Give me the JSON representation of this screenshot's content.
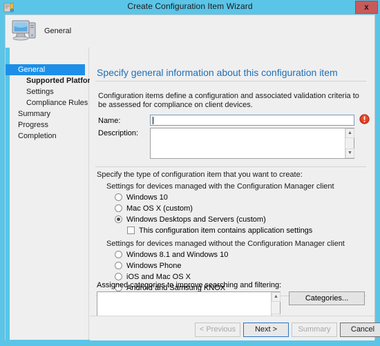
{
  "window": {
    "title": "Create Configuration Item Wizard",
    "icon": "wizard-icon",
    "close_label": "x",
    "titlebar_color": "#5bc5e8"
  },
  "header": {
    "icon": "computer-monitor-icon",
    "label": "General"
  },
  "sidebar": {
    "items": [
      {
        "label": "General",
        "level": 0,
        "active": true,
        "bold": false
      },
      {
        "label": "Supported Platforms",
        "level": 1,
        "active": false,
        "bold": true
      },
      {
        "label": "Settings",
        "level": 1,
        "active": false,
        "bold": false
      },
      {
        "label": "Compliance Rules",
        "level": 1,
        "active": false,
        "bold": false
      },
      {
        "label": "Summary",
        "level": 0,
        "active": false,
        "bold": false
      },
      {
        "label": "Progress",
        "level": 0,
        "active": false,
        "bold": false
      },
      {
        "label": "Completion",
        "level": 0,
        "active": false,
        "bold": false
      }
    ],
    "active_color": "#1d8fe8"
  },
  "content": {
    "title": "Specify general information about this configuration item",
    "title_color": "#1f6fb4",
    "intro": "Configuration items define a configuration and associated validation criteria to be assessed for compliance on client devices.",
    "name_label": "Name:",
    "name_value": "",
    "name_error_icon": "error-exclamation-icon",
    "description_label": "Description:",
    "description_value": "",
    "scroll_up_icon": "chevron-up-icon",
    "scroll_down_icon": "chevron-down-icon",
    "type_prompt": "Specify the type of configuration item that you want to create:",
    "managed_group_label": "Settings for devices managed with the Configuration Manager client",
    "managed_options": [
      {
        "label": "Windows 10",
        "selected": false
      },
      {
        "label": "Mac OS X (custom)",
        "selected": false
      },
      {
        "label": "Windows Desktops and Servers (custom)",
        "selected": true
      }
    ],
    "app_settings_checkbox": {
      "label": "This configuration item contains application settings",
      "checked": false
    },
    "unmanaged_group_label": "Settings for devices managed without the Configuration Manager client",
    "unmanaged_options": [
      {
        "label": "Windows 8.1 and Windows 10",
        "selected": false
      },
      {
        "label": "Windows Phone",
        "selected": false
      },
      {
        "label": "iOS and Mac OS X",
        "selected": false
      },
      {
        "label": "Android and Samsung KNOX",
        "selected": false
      }
    ],
    "categories_label": "Assigned categories to improve searching and filtering:",
    "categories_value": "",
    "categories_button": "Categories..."
  },
  "footer": {
    "previous": "< Previous",
    "next": "Next >",
    "summary": "Summary",
    "cancel": "Cancel"
  }
}
